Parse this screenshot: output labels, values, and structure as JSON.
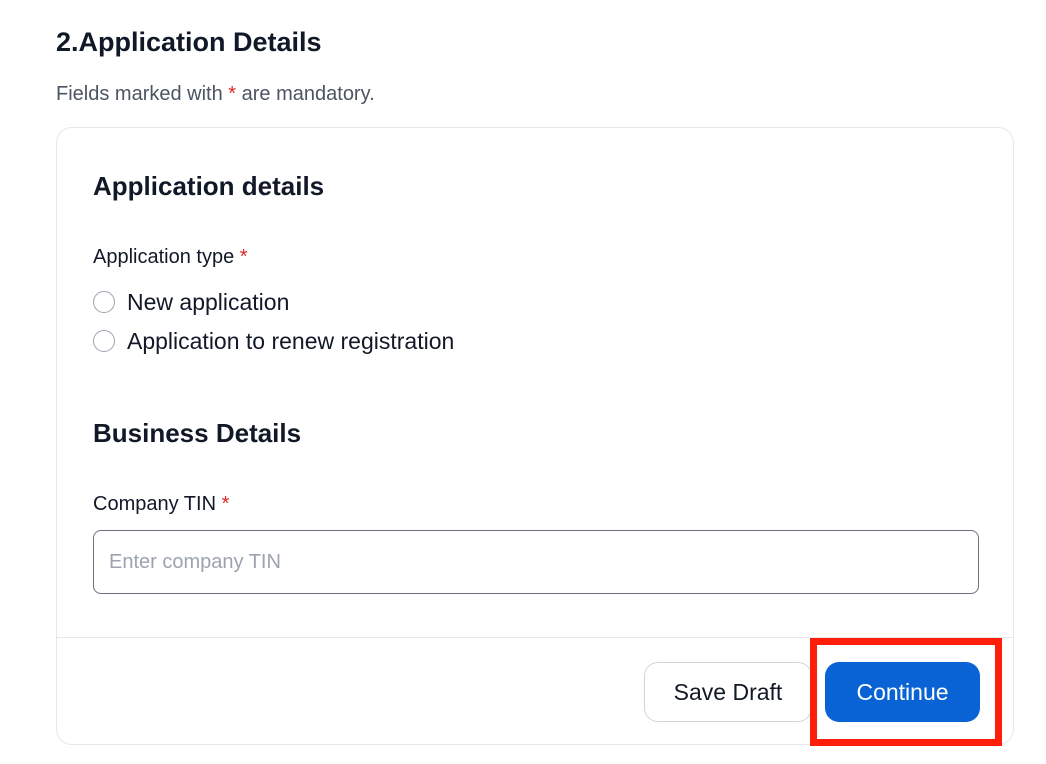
{
  "section": {
    "title": "2.Application Details",
    "note_prefix": "Fields marked with",
    "note_asterisk": "*",
    "note_suffix": "are mandatory."
  },
  "card": {
    "application_heading": "Application details",
    "application_type_label": "Application type",
    "required_marker": "*",
    "application_type_options": [
      {
        "label": "New application",
        "selected": false
      },
      {
        "label": "Application to renew registration",
        "selected": false
      }
    ],
    "business_heading": "Business Details",
    "company_tin_label": "Company TIN",
    "company_tin_value": "",
    "company_tin_placeholder": "Enter company TIN"
  },
  "footer": {
    "save_draft_label": "Save Draft",
    "continue_label": "Continue"
  },
  "colors": {
    "primary": "#0a63d4",
    "required": "#dc2626",
    "highlight": "#ff1e0a"
  }
}
